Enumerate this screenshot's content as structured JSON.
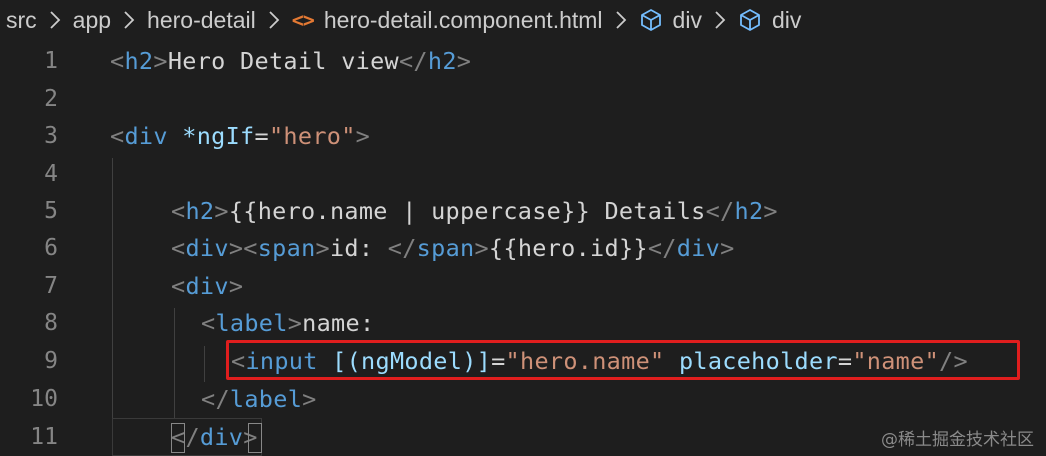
{
  "breadcrumb": {
    "items": [
      {
        "label": "src"
      },
      {
        "label": "app"
      },
      {
        "label": "hero-detail"
      },
      {
        "label": "hero-detail.component.html",
        "icon": "html-file-icon"
      },
      {
        "label": "div",
        "icon": "element-cube-icon"
      },
      {
        "label": "div",
        "icon": "element-cube-icon"
      }
    ]
  },
  "editor": {
    "line_numbers": [
      "1",
      "2",
      "3",
      "4",
      "5",
      "6",
      "7",
      "8",
      "9",
      "10",
      "11"
    ],
    "lines": {
      "l1": {
        "open": "<",
        "tag": "h2",
        "close": ">",
        "text": "Hero Detail view",
        "end_open": "</",
        "end_tag": "h2",
        "end_close": ">"
      },
      "l3": {
        "open": "<",
        "tag": "div",
        "attr": "*ngIf",
        "eq": "=",
        "value": "\"hero\"",
        "close": ">"
      },
      "l5": {
        "open": "<",
        "tag": "h2",
        "close": ">",
        "text": "{{hero.name | uppercase}} Details",
        "end_open": "</",
        "end_tag": "h2",
        "end_close": ">"
      },
      "l6": {
        "open": "<",
        "tag": "div",
        "close": "><",
        "tag2": "span",
        "close2": ">",
        "text": "id: ",
        "end_open": "</",
        "end_tag": "span",
        "end_close": ">",
        "text2": "{{hero.id}}",
        "end_open2": "</",
        "end_tag2": "div",
        "end_close2": ">"
      },
      "l7": {
        "open": "<",
        "tag": "div",
        "close": ">"
      },
      "l8": {
        "open": "<",
        "tag": "label",
        "close": ">",
        "text": "name:"
      },
      "l9": {
        "open": "<",
        "tag": "input",
        "attr": "[(ngModel)]",
        "eq": "=",
        "value": "\"hero.name\"",
        "attr2": "placeholder",
        "eq2": "=",
        "value2": "\"name\"",
        "close": "/>"
      },
      "l10": {
        "end_open": "</",
        "end_tag": "label",
        "end_close": ">"
      },
      "l11": {
        "end_open": "</",
        "end_tag": "div",
        "end_close": ">"
      }
    }
  },
  "colors": {
    "background": "#1e1e1e",
    "tag_name": "#569cd6",
    "attribute_name": "#9cdcfe",
    "attribute_value": "#ce9178",
    "highlight_border": "#e01e1e"
  },
  "watermark": "@稀土掘金技术社区"
}
